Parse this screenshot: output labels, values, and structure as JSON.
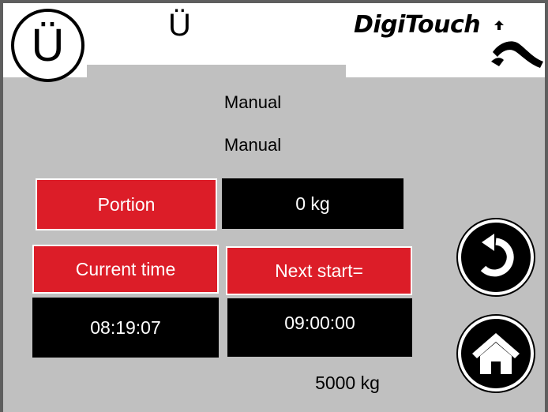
{
  "header": {
    "circle_label": "Ü",
    "plain_label": "Ü",
    "logo_text": "DigiTouch"
  },
  "mode": {
    "line1": "Manual",
    "line2": "Manual"
  },
  "portion": {
    "label": "Portion",
    "value": "0 kg"
  },
  "time": {
    "current_label": "Current time",
    "current_value": "08:19:07",
    "next_label": "Next start=",
    "next_value": "09:00:00"
  },
  "weight": "5000 kg",
  "buttons": {
    "back_icon": "back-arrow-icon",
    "home_icon": "home-icon"
  },
  "colors": {
    "accent_red": "#dc1d28",
    "background": "#c0c0c0",
    "value_bg": "#000000"
  }
}
